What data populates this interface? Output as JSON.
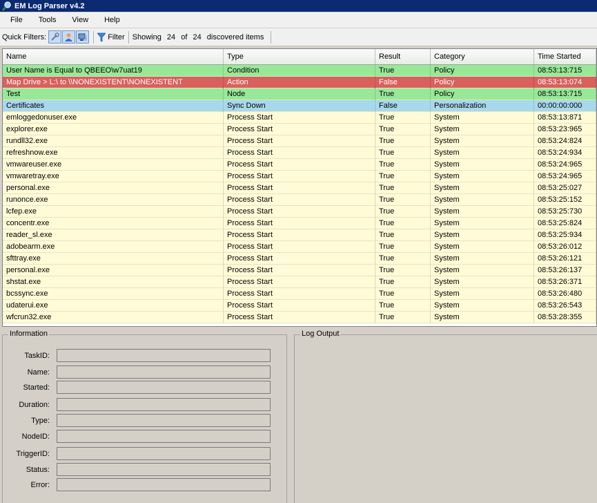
{
  "window": {
    "title": "EM Log Parser v4.2"
  },
  "menu": [
    "File",
    "Tools",
    "View",
    "Help"
  ],
  "toolbar": {
    "quick_filters_label": "Quick Filters:",
    "filter_label": "Filter",
    "showing_label": "Showing",
    "shown_count": "24",
    "of_label": "of",
    "total_count": "24",
    "discovered_label": "discovered items"
  },
  "table": {
    "columns": [
      "Name",
      "Type",
      "Result",
      "Category",
      "Time Started"
    ],
    "rows": [
      {
        "status": "green",
        "cells": [
          "User Name is Equal to QBEEO\\w7uat19",
          "Condition",
          "True",
          "Policy",
          "08:53:13:715"
        ]
      },
      {
        "status": "red",
        "cells": [
          "Map Drive > L:\\ to \\\\NONEXISTENT\\NONEXISTENT",
          "Action",
          "False",
          "Policy",
          "08:53:13:074"
        ]
      },
      {
        "status": "green",
        "cells": [
          "Test",
          "Node",
          "True",
          "Policy",
          "08:53:13:715"
        ]
      },
      {
        "status": "blue",
        "cells": [
          "Certificates",
          "Sync Down",
          "False",
          "Personalization",
          "00:00:00:000"
        ]
      },
      {
        "status": "default",
        "cells": [
          "emloggedonuser.exe",
          "Process Start",
          "True",
          "System",
          "08:53:13:871"
        ]
      },
      {
        "status": "default",
        "cells": [
          "explorer.exe",
          "Process Start",
          "True",
          "System",
          "08:53:23:965"
        ]
      },
      {
        "status": "default",
        "cells": [
          "rundll32.exe",
          "Process Start",
          "True",
          "System",
          "08:53:24:824"
        ]
      },
      {
        "status": "default",
        "cells": [
          "refreshnow.exe",
          "Process Start",
          "True",
          "System",
          "08:53:24:934"
        ]
      },
      {
        "status": "default",
        "cells": [
          "vmwareuser.exe",
          "Process Start",
          "True",
          "System",
          "08:53:24:965"
        ]
      },
      {
        "status": "default",
        "cells": [
          "vmwaretray.exe",
          "Process Start",
          "True",
          "System",
          "08:53:24:965"
        ]
      },
      {
        "status": "default",
        "cells": [
          "personal.exe",
          "Process Start",
          "True",
          "System",
          "08:53:25:027"
        ]
      },
      {
        "status": "default",
        "cells": [
          "runonce.exe",
          "Process Start",
          "True",
          "System",
          "08:53:25:152"
        ]
      },
      {
        "status": "default",
        "cells": [
          "lcfep.exe",
          "Process Start",
          "True",
          "System",
          "08:53:25:730"
        ]
      },
      {
        "status": "default",
        "cells": [
          "concentr.exe",
          "Process Start",
          "True",
          "System",
          "08:53:25:824"
        ]
      },
      {
        "status": "default",
        "cells": [
          "reader_sl.exe",
          "Process Start",
          "True",
          "System",
          "08:53:25:934"
        ]
      },
      {
        "status": "default",
        "cells": [
          "adobearm.exe",
          "Process Start",
          "True",
          "System",
          "08:53:26:012"
        ]
      },
      {
        "status": "default",
        "cells": [
          "sfttray.exe",
          "Process Start",
          "True",
          "System",
          "08:53:26:121"
        ]
      },
      {
        "status": "default",
        "cells": [
          "personal.exe",
          "Process Start",
          "True",
          "System",
          "08:53:26:137"
        ]
      },
      {
        "status": "default",
        "cells": [
          "shstat.exe",
          "Process Start",
          "True",
          "System",
          "08:53:26:371"
        ]
      },
      {
        "status": "default",
        "cells": [
          "bcssync.exe",
          "Process Start",
          "True",
          "System",
          "08:53:26:480"
        ]
      },
      {
        "status": "default",
        "cells": [
          "udaterui.exe",
          "Process Start",
          "True",
          "System",
          "08:53:26:543"
        ]
      },
      {
        "status": "default",
        "cells": [
          "wfcrun32.exe",
          "Process Start",
          "True",
          "System",
          "08:53:28:355"
        ]
      }
    ]
  },
  "information": {
    "title": "Information",
    "fields": [
      {
        "label": "TaskID:",
        "value": ""
      },
      {
        "label": "Name:",
        "value": ""
      },
      {
        "label": "Started:",
        "value": ""
      },
      {
        "label": "Duration:",
        "value": ""
      },
      {
        "label": "Type:",
        "value": ""
      },
      {
        "label": "NodeID:",
        "value": ""
      },
      {
        "label": "TriggerID:",
        "value": ""
      },
      {
        "label": "Status:",
        "value": ""
      },
      {
        "label": "Error:",
        "value": ""
      }
    ]
  },
  "log_output": {
    "title": "Log Output"
  },
  "colors": {
    "green_row": "#98e898",
    "red_row": "#d9605c",
    "blue_row": "#a8d8ec",
    "default_row": "#fffbd6",
    "titlebar": "#0c2a72"
  }
}
